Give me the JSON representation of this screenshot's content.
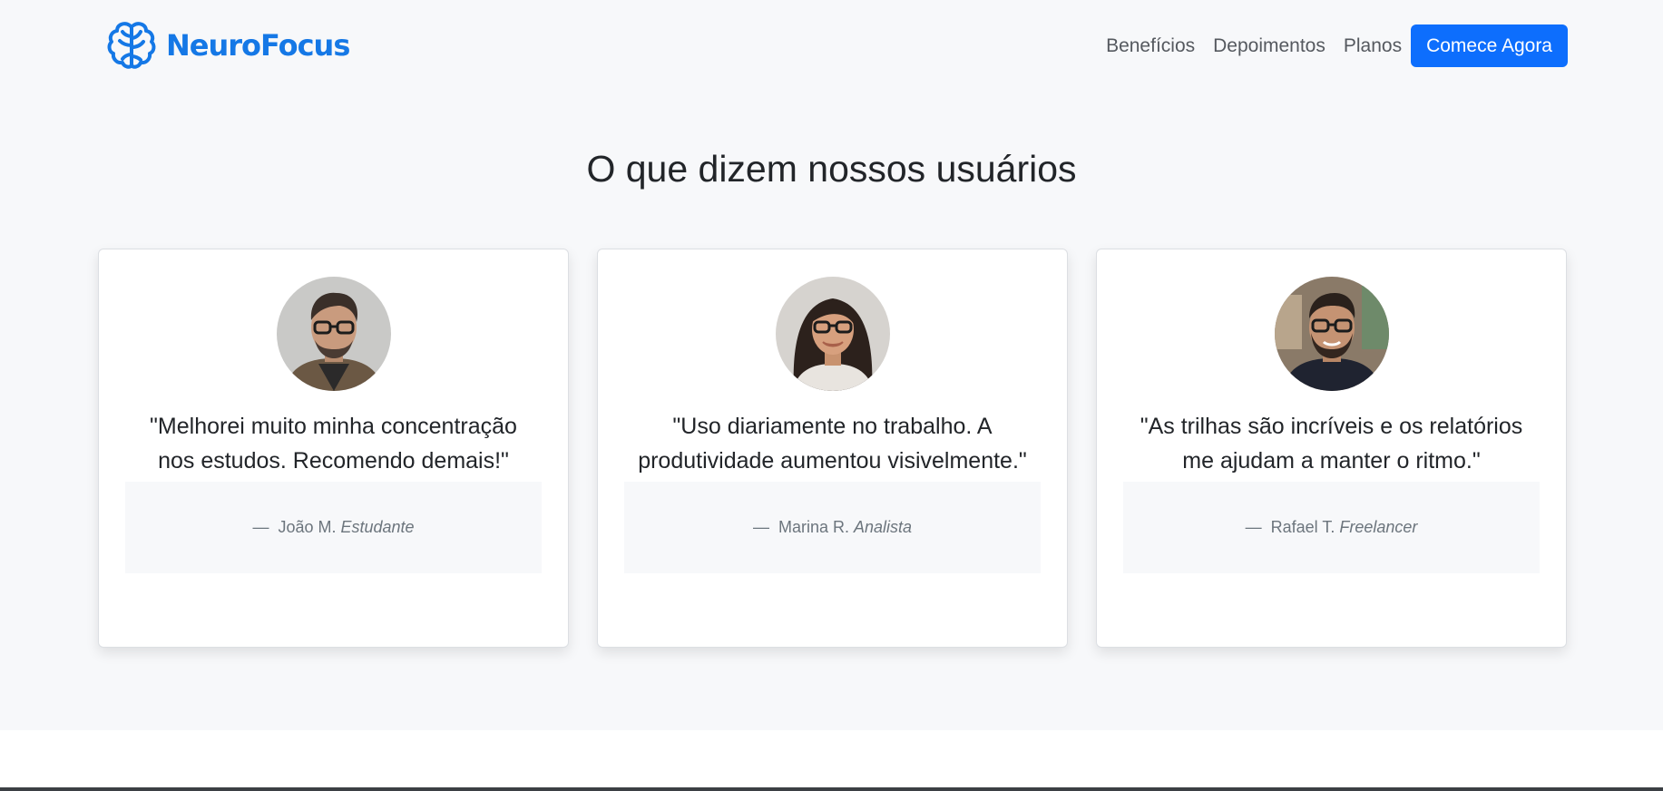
{
  "brand": {
    "name": "NeuroFocus",
    "color": "#1578e6",
    "logo_icon": "brain-icon"
  },
  "nav": {
    "links": [
      "Benefícios",
      "Depoimentos",
      "Planos"
    ],
    "cta_label": "Comece Agora",
    "cta_color": "#0d6efd"
  },
  "testimonials": {
    "title": "O que dizem nossos usuários",
    "items": [
      {
        "quote": "\"Melhorei muito minha concentração nos estudos. Recomendo demais!\"",
        "dash": "—",
        "name": "João M.",
        "role": "Estudante",
        "avatar_icon": "man-with-glasses-avatar"
      },
      {
        "quote": "\"Uso diariamente no trabalho. A produtividade aumentou visivelmente.\"",
        "dash": "—",
        "name": "Marina R.",
        "role": "Analista",
        "avatar_icon": "woman-with-glasses-avatar"
      },
      {
        "quote": "\"As trilhas são incríveis e os relatórios me ajudam a manter o ritmo.\"",
        "dash": "—",
        "name": "Rafael T.",
        "role": "Freelancer",
        "avatar_icon": "bearded-man-with-glasses-avatar"
      }
    ]
  }
}
